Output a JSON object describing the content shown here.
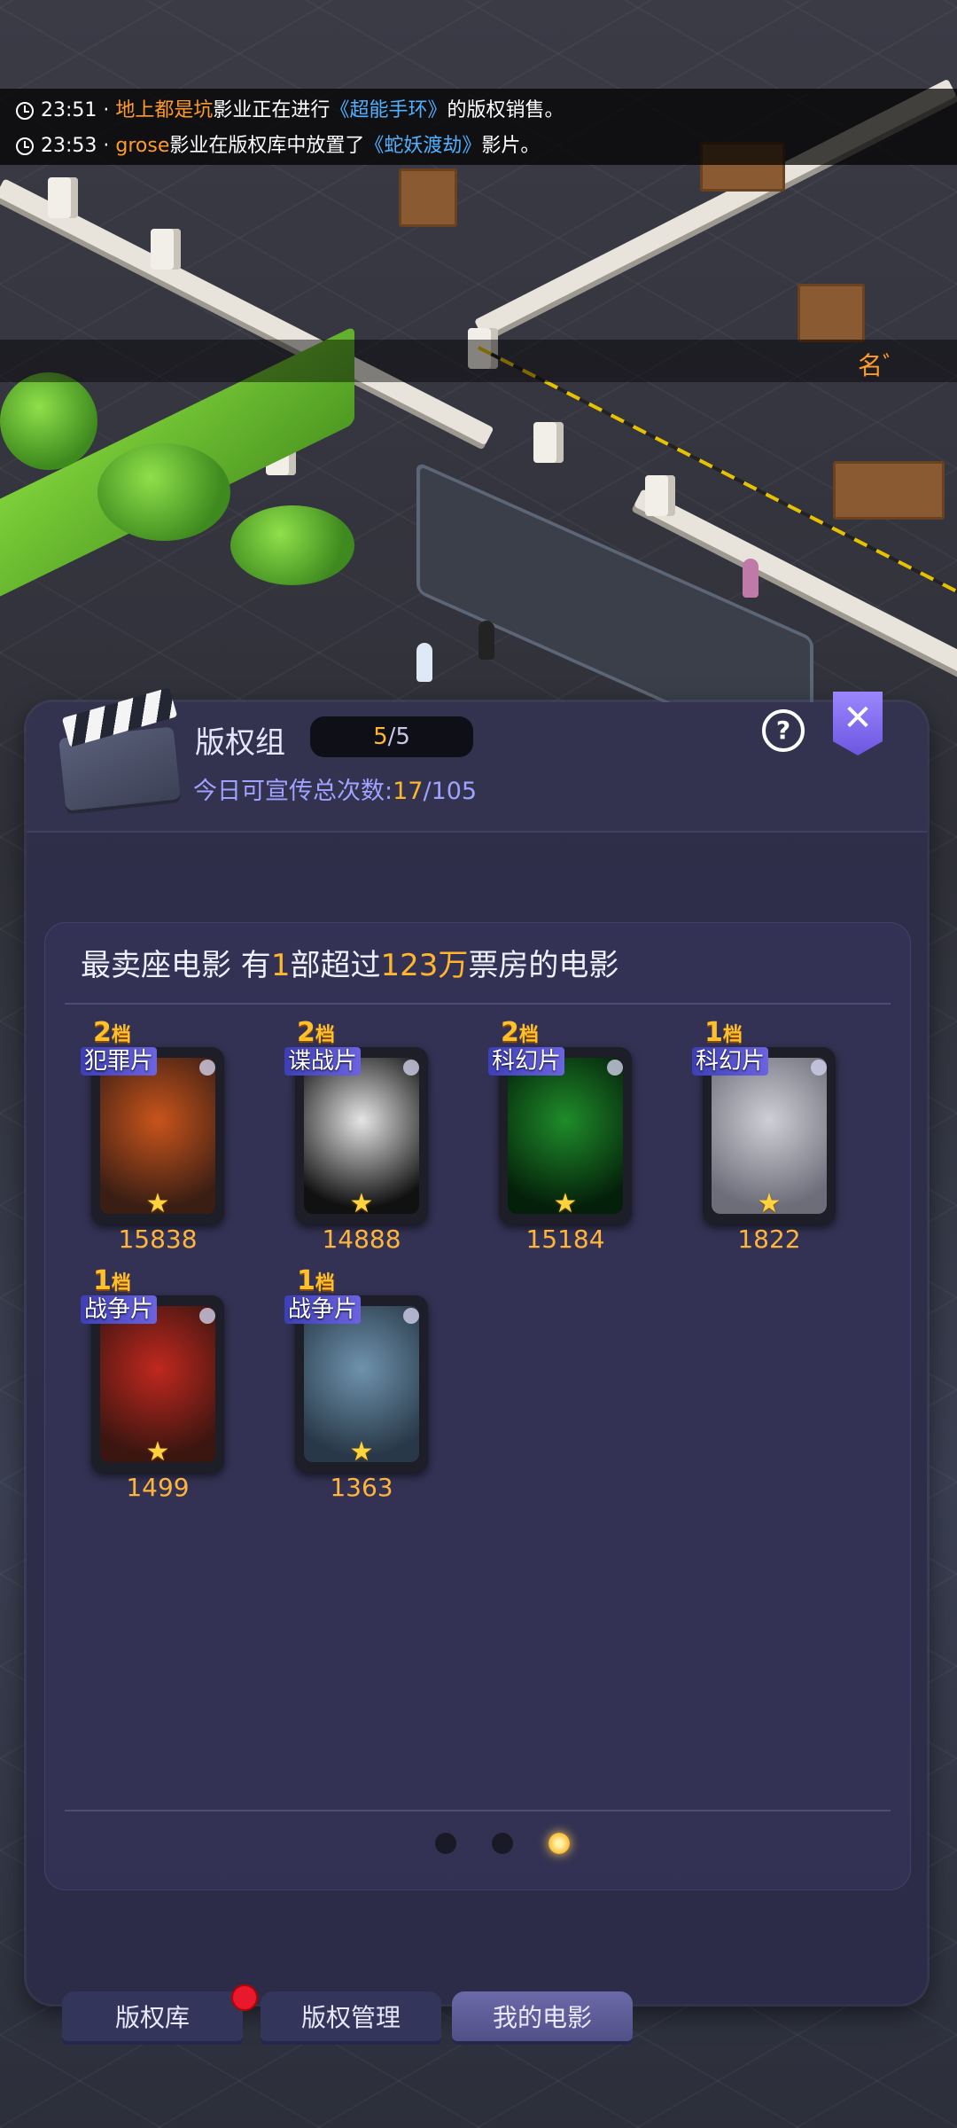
{
  "ticker": {
    "lines": [
      {
        "time": "23:51",
        "sep": "·",
        "actor": "地上都是坑",
        "mid": "影业正在进行",
        "film": "《超能手环》",
        "tail": "的版权销售。"
      },
      {
        "time": "23:53",
        "sep": "·",
        "actor": "grose",
        "mid": "影业在版权库中放置了",
        "film": "《蛇妖渡劫》",
        "tail": "影片。"
      }
    ]
  },
  "side_banner": {
    "text": "名ﾞ"
  },
  "panel": {
    "title": "版权组",
    "slots_current": "5",
    "slots_sep": "/",
    "slots_total": "5",
    "promo_label": "今日可宣传总次数:",
    "promo_current": "17",
    "promo_sep": "/",
    "promo_total": "105",
    "help_icon": "?",
    "close_icon": "✕"
  },
  "best": {
    "p1": "最卖座电影 有",
    "count": "1",
    "p2": "部超过",
    "amount": "123万",
    "p3": "票房的电影"
  },
  "films": [
    {
      "tier_num": "2",
      "tier_unit": "档",
      "genre": "犯罪片",
      "box": "15838",
      "colors": [
        "#c9541b",
        "#3a1e14"
      ]
    },
    {
      "tier_num": "2",
      "tier_unit": "档",
      "genre": "谍战片",
      "box": "14888",
      "colors": [
        "#e5e5e5",
        "#111111"
      ]
    },
    {
      "tier_num": "2",
      "tier_unit": "档",
      "genre": "科幻片",
      "box": "15184",
      "colors": [
        "#1f8c2a",
        "#04200a"
      ]
    },
    {
      "tier_num": "1",
      "tier_unit": "档",
      "genre": "科幻片",
      "box": "1822",
      "colors": [
        "#cfcfd6",
        "#6d6d7a"
      ]
    },
    {
      "tier_num": "1",
      "tier_unit": "档",
      "genre": "战争片",
      "box": "1499",
      "colors": [
        "#c0281e",
        "#3b1510"
      ]
    },
    {
      "tier_num": "1",
      "tier_unit": "档",
      "genre": "战争片",
      "box": "1363",
      "colors": [
        "#6f93ad",
        "#283848"
      ]
    }
  ],
  "pagination": {
    "count": 3,
    "active": 3
  },
  "tabs": [
    {
      "label": "版权库",
      "active": false,
      "badge": true
    },
    {
      "label": "版权管理",
      "active": false,
      "badge": false
    },
    {
      "label": "我的电影",
      "active": true,
      "badge": false
    }
  ],
  "colors": {
    "accent_orange": "#ffb62a",
    "link_blue": "#4fb1ff",
    "panel_bg": "#2f2f4a"
  }
}
